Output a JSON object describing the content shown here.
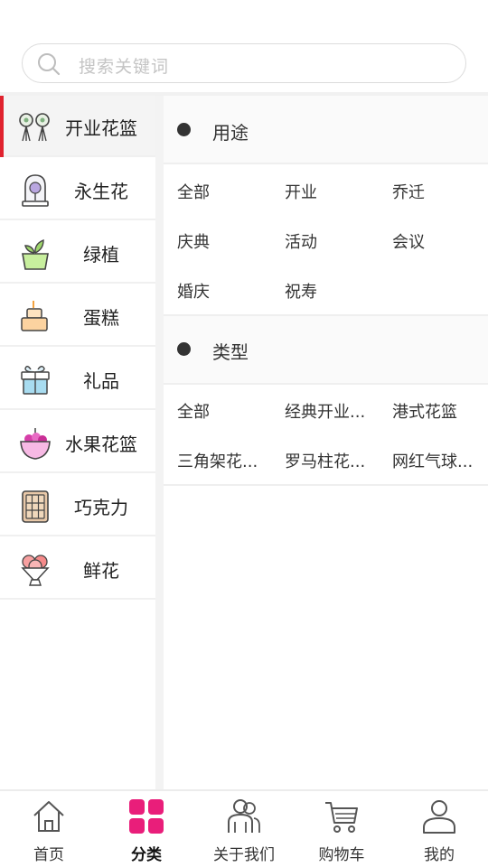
{
  "search": {
    "placeholder": "搜索关键词"
  },
  "sidebar": {
    "items": [
      {
        "label": "开业花篮",
        "icon": "flower-basket-icon",
        "active": true
      },
      {
        "label": "永生花",
        "icon": "preserved-flower-icon",
        "active": false
      },
      {
        "label": "绿植",
        "icon": "plant-icon",
        "active": false
      },
      {
        "label": "蛋糕",
        "icon": "cake-icon",
        "active": false
      },
      {
        "label": "礼品",
        "icon": "gift-icon",
        "active": false
      },
      {
        "label": "水果花篮",
        "icon": "fruit-basket-icon",
        "active": false
      },
      {
        "label": "巧克力",
        "icon": "chocolate-icon",
        "active": false
      },
      {
        "label": "鲜花",
        "icon": "bouquet-icon",
        "active": false
      }
    ]
  },
  "sections": [
    {
      "title": "用途",
      "options": [
        "全部",
        "开业",
        "乔迁",
        "庆典",
        "活动",
        "会议",
        "婚庆",
        "祝寿"
      ]
    },
    {
      "title": "类型",
      "options": [
        "全部",
        "经典开业...",
        "港式花篮",
        "三角架花...",
        "罗马柱花...",
        "网红气球..."
      ]
    }
  ],
  "tabbar": {
    "items": [
      {
        "label": "首页",
        "icon": "home-icon",
        "active": false
      },
      {
        "label": "分类",
        "icon": "category-icon",
        "active": true
      },
      {
        "label": "关于我们",
        "icon": "about-us-icon",
        "active": false
      },
      {
        "label": "购物车",
        "icon": "cart-icon",
        "active": false
      },
      {
        "label": "我的",
        "icon": "profile-icon",
        "active": false
      }
    ]
  },
  "colors": {
    "accent": "#e0222e",
    "category_pink": "#e91e7a",
    "text": "#222222",
    "placeholder": "#c4c4c4"
  }
}
